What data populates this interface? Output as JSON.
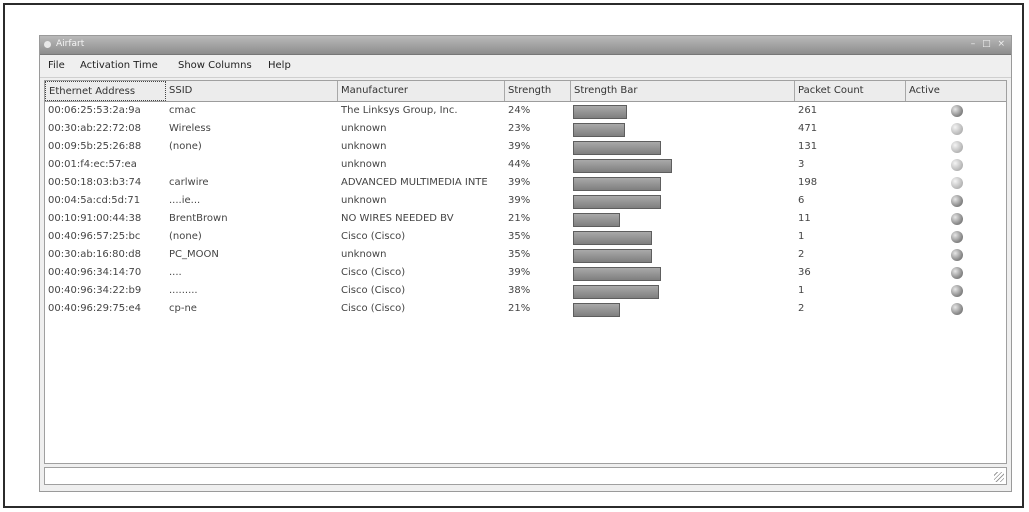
{
  "window": {
    "title": "Airfart",
    "buttons": "– □ ×"
  },
  "menu": {
    "file": "File",
    "activation_time": "Activation Time",
    "show_columns": "Show Columns",
    "help": "Help"
  },
  "columns": [
    "Ethernet Address",
    "SSID",
    "Manufacturer",
    "Strength",
    "Strength Bar",
    "Packet Count",
    "Active"
  ],
  "rows": [
    {
      "mac": "00:06:25:53:2a:9a",
      "ssid": "cmac",
      "manufacturer": "The Linksys Group, Inc.",
      "strength": "24%",
      "strength_value": 24,
      "packets": "261",
      "active": "dark"
    },
    {
      "mac": "00:30:ab:22:72:08",
      "ssid": "Wireless",
      "manufacturer": "unknown",
      "strength": "23%",
      "strength_value": 23,
      "packets": "471",
      "active": "light"
    },
    {
      "mac": "00:09:5b:25:26:88",
      "ssid": "(none)",
      "manufacturer": "unknown",
      "strength": "39%",
      "strength_value": 39,
      "packets": "131",
      "active": "light"
    },
    {
      "mac": "00:01:f4:ec:57:ea",
      "ssid": "",
      "manufacturer": "unknown",
      "strength": "44%",
      "strength_value": 44,
      "packets": "3",
      "active": "light"
    },
    {
      "mac": "00:50:18:03:b3:74",
      "ssid": "carlwire",
      "manufacturer": "ADVANCED MULTIMEDIA INTE",
      "strength": "39%",
      "strength_value": 39,
      "packets": "198",
      "active": "light"
    },
    {
      "mac": "00:04:5a:cd:5d:71",
      "ssid": "....ie...",
      "manufacturer": "unknown",
      "strength": "39%",
      "strength_value": 39,
      "packets": "6",
      "active": "dark"
    },
    {
      "mac": "00:10:91:00:44:38",
      "ssid": "BrentBrown",
      "manufacturer": "NO WIRES NEEDED BV",
      "strength": "21%",
      "strength_value": 21,
      "packets": "11",
      "active": "dark"
    },
    {
      "mac": "00:40:96:57:25:bc",
      "ssid": "(none)",
      "manufacturer": "Cisco (Cisco)",
      "strength": "35%",
      "strength_value": 35,
      "packets": "1",
      "active": "dark"
    },
    {
      "mac": "00:30:ab:16:80:d8",
      "ssid": "PC_MOON",
      "manufacturer": "unknown",
      "strength": "35%",
      "strength_value": 35,
      "packets": "2",
      "active": "dark"
    },
    {
      "mac": "00:40:96:34:14:70",
      "ssid": "....",
      "manufacturer": "Cisco (Cisco)",
      "strength": "39%",
      "strength_value": 39,
      "packets": "36",
      "active": "dark"
    },
    {
      "mac": "00:40:96:34:22:b9",
      "ssid": ".........",
      "manufacturer": "Cisco (Cisco)",
      "strength": "38%",
      "strength_value": 38,
      "packets": "1",
      "active": "dark"
    },
    {
      "mac": "00:40:96:29:75:e4",
      "ssid": "cp-ne",
      "manufacturer": "Cisco (Cisco)",
      "strength": "21%",
      "strength_value": 21,
      "packets": "2",
      "active": "dark"
    }
  ],
  "status_text": ""
}
